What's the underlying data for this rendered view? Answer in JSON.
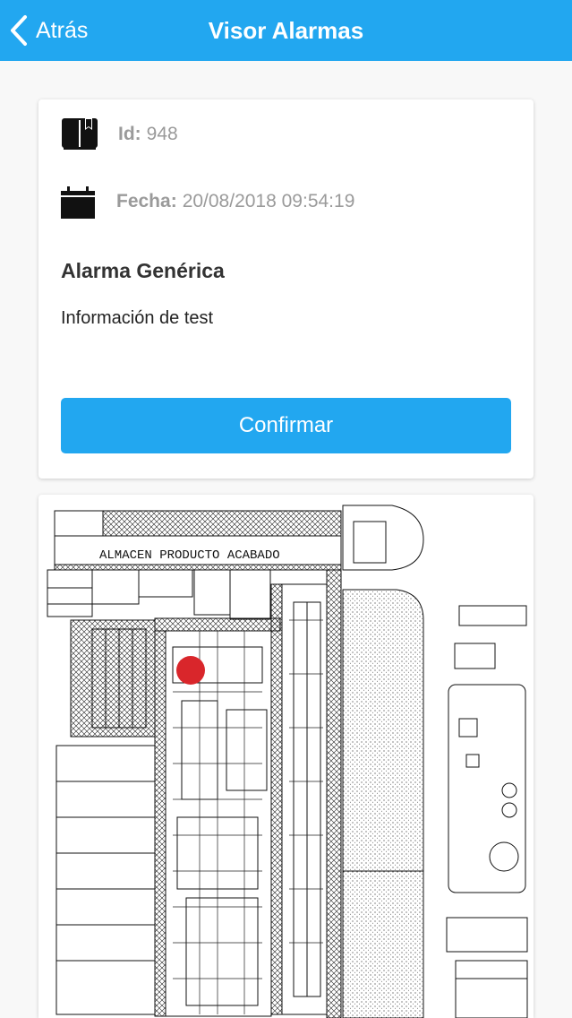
{
  "nav": {
    "back_label": "Atrás",
    "title": "Visor Alarmas"
  },
  "alarm": {
    "id_label": "Id:",
    "id_value": "948",
    "date_label": "Fecha:",
    "date_value": "20/08/2018 09:54:19",
    "title": "Alarma Genérica",
    "info": "Información de test",
    "confirm_label": "Confirmar"
  },
  "map": {
    "area_label": "ALMACEN PRODUCTO ACABADO",
    "marker_color": "#d9262b"
  },
  "colors": {
    "accent": "#22a7f0"
  }
}
